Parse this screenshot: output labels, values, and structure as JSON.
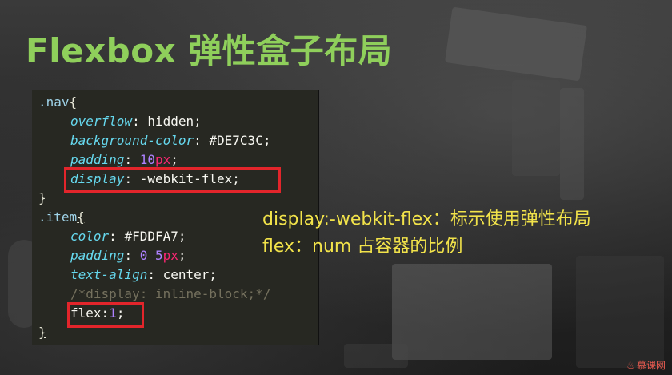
{
  "slide": {
    "title": "Flexbox 弹性盒子布局"
  },
  "code": {
    "nav_selector": ".nav",
    "open_brace": "{",
    "close_brace": "}",
    "nav_props": [
      {
        "prop": "overflow",
        "value": "hidden"
      },
      {
        "prop": "background-color",
        "value": "#DE7C3C"
      },
      {
        "prop": "padding",
        "num": "10",
        "unit": "px"
      },
      {
        "prop": "display",
        "value": "-webkit-flex"
      }
    ],
    "item_selector": ".item",
    "item_props": [
      {
        "prop": "color",
        "value": "#FDDFA7"
      },
      {
        "prop": "padding",
        "num1": "0",
        "num2": "5",
        "unit": "px"
      },
      {
        "prop": "text-align",
        "value": "center"
      }
    ],
    "comment": "/*display: inline-block;*/",
    "flex_prop": "flex",
    "flex_value": "1"
  },
  "notes": {
    "line1": "display:-webkit-flex：标示使用弹性布局",
    "line2": "flex：num  占容器的比例"
  },
  "highlight_color": "#e2252b",
  "watermark": {
    "icon": "flame-icon",
    "text": "慕课网"
  }
}
